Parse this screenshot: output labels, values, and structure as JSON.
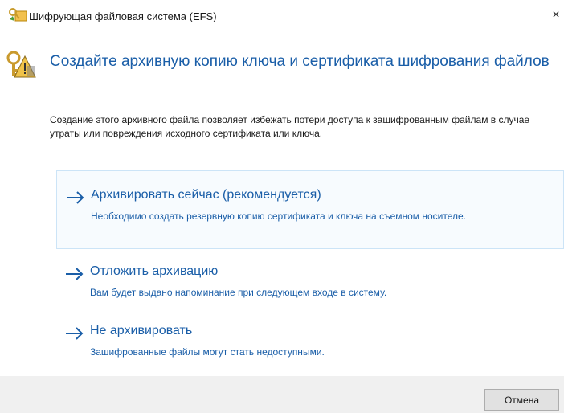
{
  "window": {
    "title": "Шифрующая файловая система (EFS)",
    "close_glyph": "×"
  },
  "header": {
    "icon": "certificate-key-icon",
    "title": "Создайте архивную копию ключа и сертификата шифрования файлов"
  },
  "description": "Создание этого архивного файла позволяет избежать потери доступа к зашифрованным файлам в случае утраты или повреждения исходного сертификата или ключа.",
  "options": [
    {
      "icon": "arrow-right-icon",
      "title": "Архивировать сейчас (рекомендуется)",
      "description": "Необходимо создать резервную копию сертификата и ключа на съемном носителе.",
      "selected": true
    },
    {
      "icon": "arrow-right-icon",
      "title": "Отложить архивацию",
      "description": "Вам будет выдано напоминание при следующем входе в систему.",
      "selected": false
    },
    {
      "icon": "arrow-right-icon",
      "title": "Не архивировать",
      "description": "Зашифрованные файлы могут стать недоступными.",
      "selected": false
    }
  ],
  "footer": {
    "cancel_label": "Отмена"
  },
  "colors": {
    "link": "#1a5ea8",
    "selected_border": "#cce4f7",
    "footer_bg": "#f0f0f0"
  }
}
